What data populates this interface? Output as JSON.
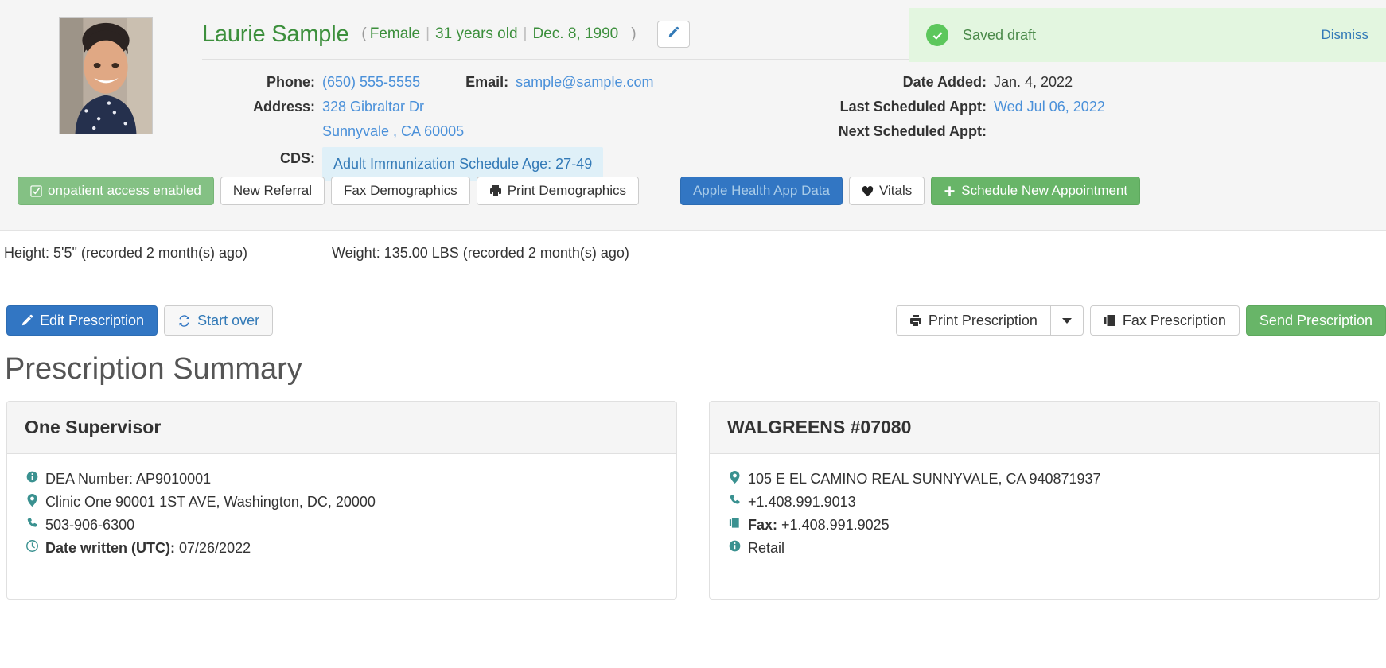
{
  "patient": {
    "name": "Laurie Sample",
    "paren_open": "(",
    "paren_close": ")",
    "gender": "Female",
    "age": "31 years old",
    "dob": "Dec. 8, 1990",
    "sep": "|",
    "edit_icon": "pencil-icon",
    "phone_label": "Phone:",
    "phone_value": "(650) 555-5555",
    "email_label": "Email:",
    "email_value": "sample@sample.com",
    "address_label": "Address:",
    "address_line1": "328 Gibraltar Dr",
    "address_line2": "Sunnyvale , CA 60005",
    "cds_label": "CDS:",
    "cds_value": "Adult Immunization Schedule Age: 27-49",
    "date_added_label": "Date Added:",
    "date_added_value": "Jan. 4, 2022",
    "last_appt_label": "Last Scheduled Appt:",
    "last_appt_value": "Wed Jul 06, 2022",
    "next_appt_label": "Next Scheduled Appt:",
    "next_appt_value": ""
  },
  "toast": {
    "icon": "check-circle-icon",
    "message": "Saved draft",
    "dismiss_label": "Dismiss",
    "bg_color": "#e3f6e0",
    "accent_color": "#5cc75c"
  },
  "action_bar": {
    "onpatient_label": "onpatient access enabled",
    "onpatient_icon": "check-square-icon",
    "new_referral_label": "New Referral",
    "fax_demographics_label": "Fax Demographics",
    "print_demographics_label": "Print Demographics",
    "print_demographics_icon": "printer-icon",
    "apple_health_label": "Apple Health App Data",
    "vitals_label": "Vitals",
    "vitals_icon": "heart-icon",
    "schedule_label": "Schedule New Appointment",
    "schedule_icon": "plus-icon"
  },
  "vitals": {
    "height": "Height: 5'5\" (recorded 2 month(s) ago)",
    "weight": "Weight: 135.00 LBS (recorded 2 month(s) ago)"
  },
  "rx_actions": {
    "edit_prescription_label": "Edit Prescription",
    "edit_prescription_icon": "pencil-icon",
    "start_over_label": "Start over",
    "start_over_icon": "refresh-icon",
    "print_prescription_label": "Print Prescription",
    "print_prescription_icon": "printer-icon",
    "print_caret_icon": "caret-down-icon",
    "fax_prescription_label": "Fax Prescription",
    "fax_prescription_icon": "fax-icon",
    "send_prescription_label": "Send Prescription"
  },
  "summary": {
    "title": "Prescription Summary",
    "cards": [
      {
        "header": "One Supervisor",
        "lines": [
          {
            "icon": "info-circle-icon",
            "bold": "",
            "text": "DEA Number: AP9010001"
          },
          {
            "icon": "map-marker-icon",
            "bold": "",
            "text": "Clinic One 90001 1ST AVE, Washington, DC, 20000"
          },
          {
            "icon": "phone-icon",
            "bold": "",
            "text": "503-906-6300"
          },
          {
            "icon": "clock-icon",
            "bold": "Date written (UTC):",
            "text": "07/26/2022"
          }
        ]
      },
      {
        "header": "WALGREENS #07080",
        "lines": [
          {
            "icon": "map-marker-icon",
            "bold": "",
            "text": "105 E EL CAMINO REAL SUNNYVALE, CA 940871937"
          },
          {
            "icon": "phone-icon",
            "bold": "",
            "text": "+1.408.991.9013"
          },
          {
            "icon": "fax-icon",
            "bold": "Fax:",
            "text": "+1.408.991.9025"
          },
          {
            "icon": "info-circle-icon",
            "bold": "",
            "text": "Retail"
          }
        ]
      }
    ]
  },
  "colors": {
    "name_green": "#3c8f3c",
    "link_blue": "#4a90d9",
    "icon_teal": "#3a9190",
    "primary_blue": "#3276c3",
    "success_green": "#68b568"
  }
}
